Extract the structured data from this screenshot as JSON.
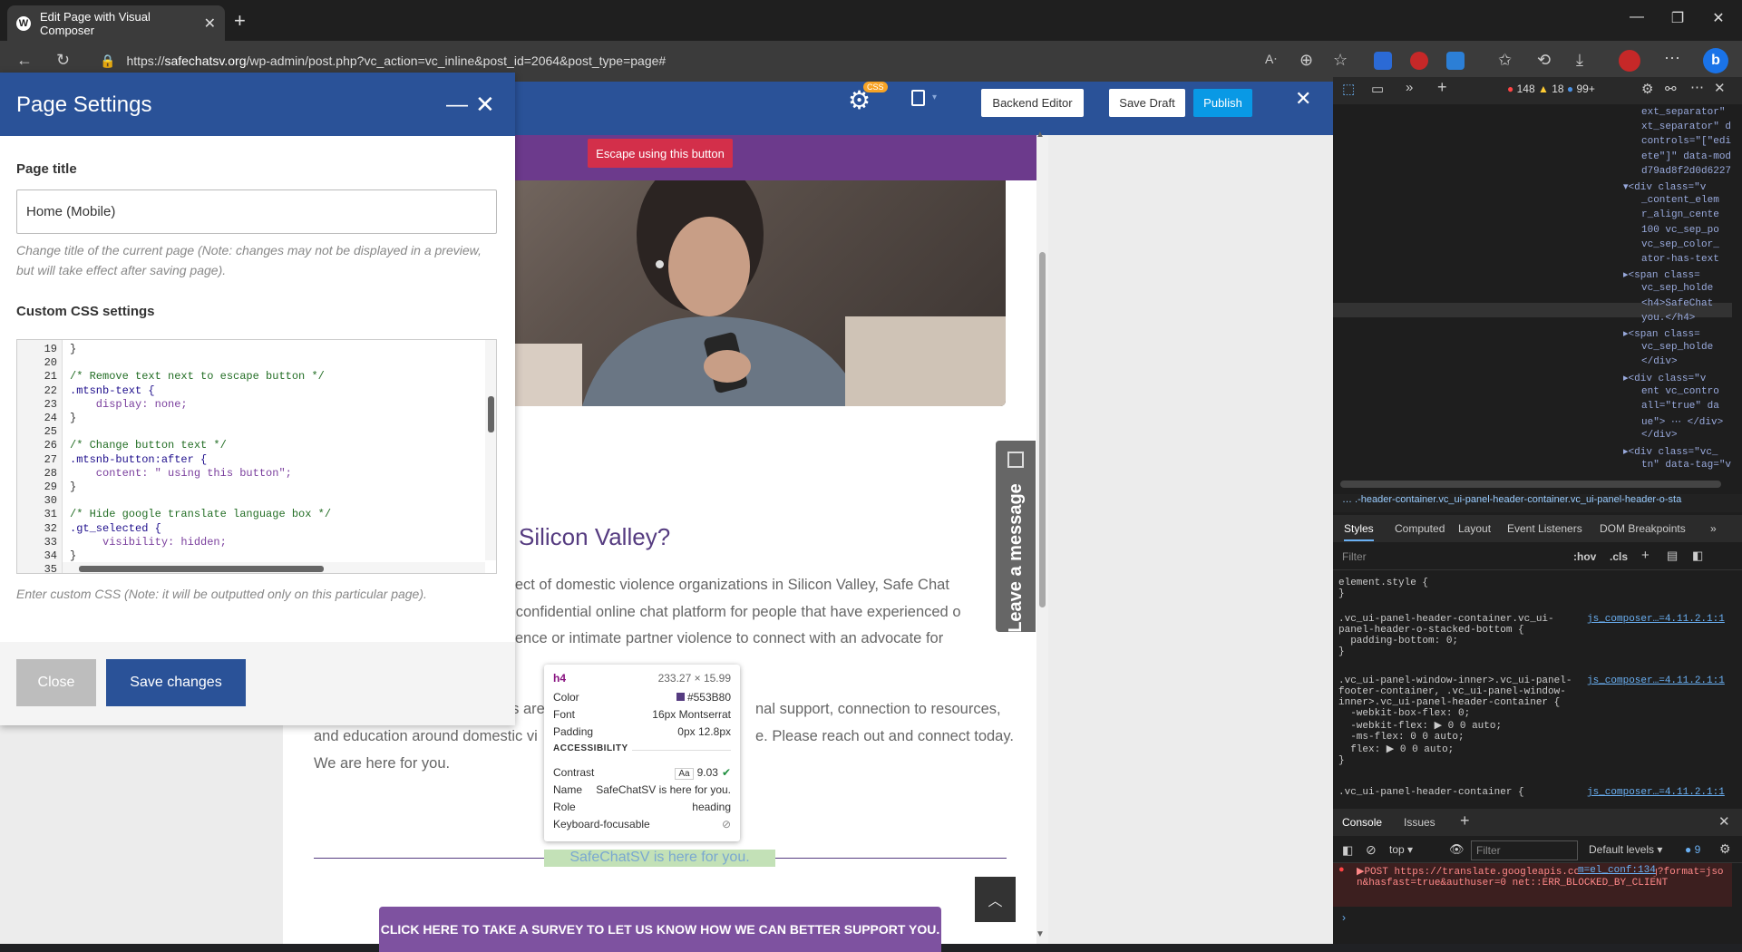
{
  "browser": {
    "tab_title": "Edit Page with Visual Composer",
    "url_host": "safechatsv.org",
    "url_path": "/wp-admin/post.php?vc_action=vc_inline&post_id=2064&post_type=page#",
    "url_prefix": "https://"
  },
  "toolbar": {
    "css_badge": "CSS",
    "backend_editor": "Backend Editor",
    "save_draft": "Save Draft",
    "publish": "Publish"
  },
  "page": {
    "escape_button": "Escape using this button",
    "heading_partial": "Silicon Valley?",
    "para1_line1": "oject of domestic violence organizations in Silicon Valley, Safe Chat",
    "para1_line2": "a confidential online chat platform for people that have experienced o",
    "para1_line3": "olence or intimate partner violence to connect with an advocate for",
    "para2_line1a": "es are",
    "para2_line1b": "nal support, connection to resources,",
    "para2_line2a": "and education around domestic vi",
    "para2_line2b": "e. Please reach out and connect today.",
    "para2_line3": "We are here for you.",
    "separator_heading": "SafeChatSV is here for you.",
    "survey_button": "CLICK HERE TO TAKE A SURVEY TO LET US KNOW HOW WE CAN BETTER SUPPORT YOU.",
    "leave_message": "Leave a message"
  },
  "panel": {
    "title": "Page Settings",
    "page_title_label": "Page title",
    "page_title_value": "Home (Mobile)",
    "page_title_hint": "Change title of the current page (Note: changes may not be displayed in a preview, but will take effect after saving page).",
    "css_label": "Custom CSS settings",
    "css_hint": "Enter custom CSS (Note: it will be outputted only on this particular page).",
    "close_button": "Close",
    "save_button": "Save changes",
    "code_lines": [
      {
        "n": "19",
        "text": "}"
      },
      {
        "n": "20",
        "text": ""
      },
      {
        "n": "21",
        "text": "/* Remove text next to escape button */"
      },
      {
        "n": "22",
        "text": ".mtsnb-text {"
      },
      {
        "n": "23",
        "text": "    display: none;"
      },
      {
        "n": "24",
        "text": "}"
      },
      {
        "n": "25",
        "text": ""
      },
      {
        "n": "26",
        "text": "/* Change button text */"
      },
      {
        "n": "27",
        "text": ".mtsnb-button:after {"
      },
      {
        "n": "28",
        "text": "    content: \" using this button\";"
      },
      {
        "n": "29",
        "text": "}"
      },
      {
        "n": "30",
        "text": ""
      },
      {
        "n": "31",
        "text": "/* Hide google translate language box */"
      },
      {
        "n": "32",
        "text": ".gt_selected {"
      },
      {
        "n": "33",
        "text": "     visibility: hidden;"
      },
      {
        "n": "34",
        "text": "}"
      },
      {
        "n": "35",
        "text": ""
      }
    ]
  },
  "tooltip": {
    "tag": "h4",
    "size": "233.27 × 15.99",
    "color_label": "Color",
    "color_value": "#553B80",
    "font_label": "Font",
    "font_value": "16px Montserrat",
    "padding_label": "Padding",
    "padding_value": "0px 12.8px",
    "section": "ACCESSIBILITY",
    "contrast_label": "Contrast",
    "contrast_value": "9.03",
    "name_label": "Name",
    "name_value": "SafeChatSV is here for you.",
    "role_label": "Role",
    "role_value": "heading",
    "focus_label": "Keyboard-focusable"
  },
  "devtools": {
    "errors": "148",
    "warnings": "18",
    "info": "99+",
    "dom_lines": [
      "ext_separator\"",
      "xt_separator\" d",
      "controls=\"[\"edi",
      "ete\"]\" data-mod",
      "d79ad8f2d0d6227",
      "▾<div class=\"v",
      "_content_elem",
      "r_align_cente",
      "100 vc_sep_po",
      "vc_sep_color_",
      "ator-has-text",
      "▸<span class=",
      "vc_sep_holde",
      "<h4>SafeChat",
      "you.</h4>",
      "▸<span class=",
      "vc_sep_holde",
      "</div>",
      "▸<div class=\"v",
      "ent vc_contro",
      "all=\"true\" da",
      "ue\"> ⋯ </div>",
      "</div>",
      "▸<div class=\"vc_",
      "tn\" data-tag=\"v"
    ],
    "breadcrumb": "…  .-header-container.vc_ui-panel-header-container.vc_ui-panel-header-o-sta",
    "tabs": [
      "Styles",
      "Computed",
      "Layout",
      "Event Listeners",
      "DOM Breakpoints"
    ],
    "filter_placeholder": "Filter",
    "hov": ":hov",
    "cls": ".cls",
    "css_rules": [
      {
        "text": "element.style {\n}",
        "link": ""
      },
      {
        "text": ".vc_ui-panel-header-container.vc_ui-\npanel-header-o-stacked-bottom {\n  padding-bottom: 0;\n}",
        "link": "js_composer…=4.11.2.1:1"
      },
      {
        "text": ".vc_ui-panel-window-inner>.vc_ui-panel-\nfooter-container, .vc_ui-panel-window-\ninner>.vc_ui-panel-header-container {\n  -webkit-box-flex: 0;\n  -webkit-flex: ▶ 0 0 auto;\n  -ms-flex: 0 0 auto;\n  flex: ▶ 0 0 auto;\n}",
        "link": "js_composer…=4.11.2.1:1"
      },
      {
        "text": ".vc_ui-panel-header-container {",
        "link": "js_composer…=4.11.2.1:1"
      }
    ],
    "console_tabs": [
      "Console",
      "Issues"
    ],
    "context": "top",
    "console_filter": "Filter",
    "levels": "Default levels",
    "console_count": "9",
    "error_text": "▶POST https://translate.googleapis.com/element/log?format=json&hasfast=true&authuser=0 net::ERR_BLOCKED_BY_CLIENT",
    "error_link": "m=el_conf:134"
  }
}
